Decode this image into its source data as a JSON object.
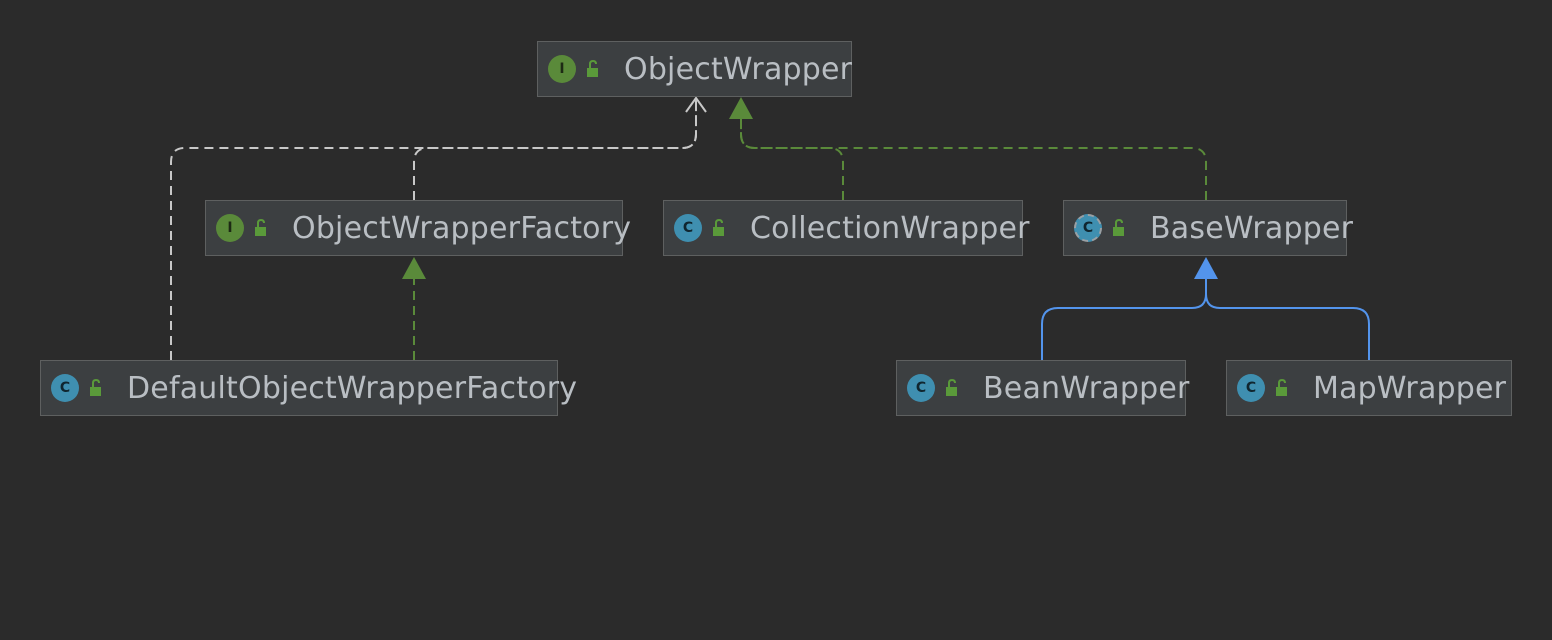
{
  "diagram": {
    "nodes": [
      {
        "id": "object-wrapper",
        "label": "ObjectWrapper",
        "kind": "interface",
        "kind_glyph": "I"
      },
      {
        "id": "object-wrapper-factory",
        "label": "ObjectWrapperFactory",
        "kind": "interface",
        "kind_glyph": "I"
      },
      {
        "id": "collection-wrapper",
        "label": "CollectionWrapper",
        "kind": "class",
        "kind_glyph": "C"
      },
      {
        "id": "base-wrapper",
        "label": "BaseWrapper",
        "kind": "abstract-class",
        "kind_glyph": "C"
      },
      {
        "id": "default-object-wrapper-factory",
        "label": "DefaultObjectWrapperFactory",
        "kind": "class",
        "kind_glyph": "C"
      },
      {
        "id": "bean-wrapper",
        "label": "BeanWrapper",
        "kind": "class",
        "kind_glyph": "C"
      },
      {
        "id": "map-wrapper",
        "label": "MapWrapper",
        "kind": "class",
        "kind_glyph": "C"
      }
    ],
    "edges": [
      {
        "from": "object-wrapper-factory",
        "to": "object-wrapper",
        "type": "dependency"
      },
      {
        "from": "default-object-wrapper-factory",
        "to": "object-wrapper",
        "type": "dependency"
      },
      {
        "from": "default-object-wrapper-factory",
        "to": "object-wrapper-factory",
        "type": "realization"
      },
      {
        "from": "collection-wrapper",
        "to": "object-wrapper",
        "type": "realization"
      },
      {
        "from": "base-wrapper",
        "to": "object-wrapper",
        "type": "realization"
      },
      {
        "from": "bean-wrapper",
        "to": "base-wrapper",
        "type": "generalization"
      },
      {
        "from": "map-wrapper",
        "to": "base-wrapper",
        "type": "generalization"
      }
    ]
  },
  "colors": {
    "background": "#2b2b2b",
    "node_fill": "#3c3f41",
    "node_border": "#5e6060",
    "label_text": "#b9bec3",
    "interface_icon": "#5a8a3a",
    "class_icon": "#3f8fb0",
    "lock_icon": "#5a9a3a",
    "dependency_line": "#c8c8c8",
    "realization_line": "#5a8a3a",
    "generalization_line": "#5394ec"
  }
}
